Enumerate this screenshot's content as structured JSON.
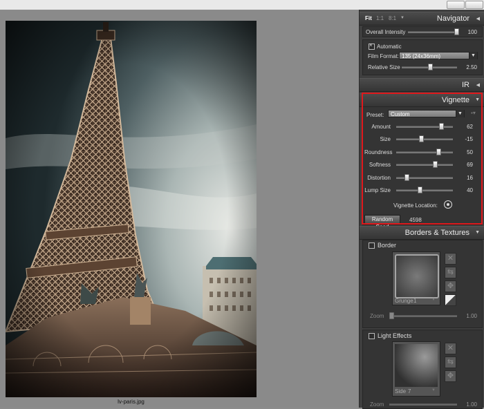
{
  "file": {
    "name": "lv-paris.jpg"
  },
  "navigator": {
    "zoom_options": [
      "Fit",
      "1:1",
      "8:1"
    ],
    "title": "Navigator",
    "overall_intensity": {
      "label": "Overall Intensity",
      "value": "100",
      "fraction": 1.0
    }
  },
  "film": {
    "automatic_label": "Automatic",
    "automatic_checked": true,
    "film_format_label": "Film Format:",
    "film_format_value": "135 (24x36mm)",
    "relative_size": {
      "label": "Relative Size",
      "value": "2.50",
      "fraction": 0.5
    }
  },
  "ir": {
    "title": "IR"
  },
  "vignette": {
    "title": "Vignette",
    "preset_label": "Preset:",
    "preset_value": "Custom",
    "sliders": [
      {
        "label": "Amount",
        "value": "62",
        "fraction": 0.81
      },
      {
        "label": "Size",
        "value": "-15",
        "fraction": 0.43
      },
      {
        "label": "Roundness",
        "value": "50",
        "fraction": 0.75
      },
      {
        "label": "Softness",
        "value": "69",
        "fraction": 0.69
      },
      {
        "label": "Distortion",
        "value": "16",
        "fraction": 0.16
      },
      {
        "label": "Lump Size",
        "value": "40",
        "fraction": 0.4
      }
    ],
    "location_label": "Vignette Location:",
    "random_seed_label": "Random Seed",
    "random_seed_value": "4598"
  },
  "borders": {
    "title": "Borders & Textures",
    "border": {
      "label": "Border",
      "texture_name": "Grunge",
      "texture_number": "1",
      "zoom_label": "Zoom",
      "zoom_value": "1.00",
      "zoom_fraction": 0.0
    },
    "light": {
      "label": "Light Effects",
      "texture_name": "Side",
      "texture_number": "7",
      "zoom_label": "Zoom",
      "zoom_value": "1.00"
    }
  }
}
